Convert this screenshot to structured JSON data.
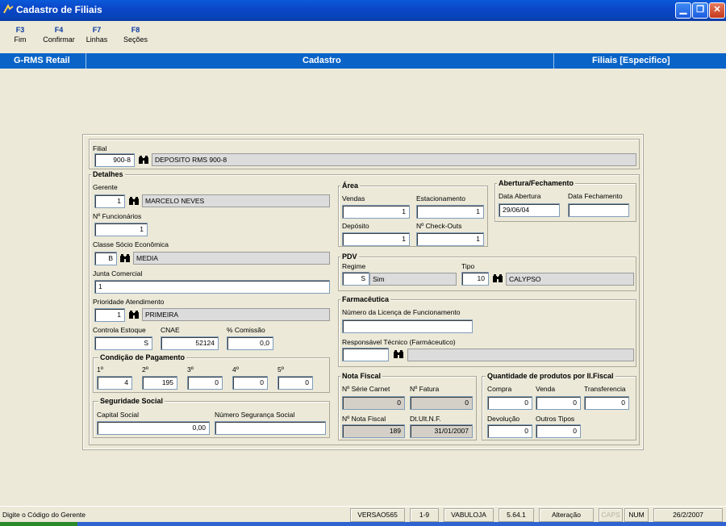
{
  "window": {
    "title": "Cadastro de Filiais"
  },
  "toolbar": {
    "keys": [
      {
        "key": "F3",
        "label": "Fim"
      },
      {
        "key": "F4",
        "label": "Confirmar"
      },
      {
        "key": "F7",
        "label": "Linhas"
      },
      {
        "key": "F8",
        "label": "Seções"
      }
    ]
  },
  "header": {
    "app": "G-RMS Retail",
    "section": "Cadastro",
    "context": "Filiais [Especifico]"
  },
  "filial": {
    "label": "Filial",
    "code": "900-8",
    "desc": "DEPOSITO RMS 900-8"
  },
  "detalhes": {
    "title": "Detalhes",
    "gerente_label": "Gerente",
    "gerente_code": "1",
    "gerente_desc": "MARCELO NEVES",
    "funcionarios_label": "Nº Funcionários",
    "funcionarios": "1",
    "classe_label": "Classe Sócio Econômica",
    "classe_code": "B",
    "classe_desc": "MEDIA",
    "junta_label": "Junta Comercial",
    "junta": "1",
    "prioridade_label": "Prioridade Atendimento",
    "prioridade_code": "1",
    "prioridade_desc": "PRIMEIRA",
    "estoque_label": "Controla Estoque",
    "estoque": "S",
    "cnae_label": "CNAE",
    "cnae": "52124",
    "comissao_label": "% Comissão",
    "comissao": "0,0"
  },
  "pagamento": {
    "title": "Condição de Pagamento",
    "labels": [
      "1º",
      "2º",
      "3º",
      "4º",
      "5º"
    ],
    "values": [
      "4",
      "195",
      "0",
      "0",
      "0"
    ]
  },
  "seguridade": {
    "title": "Seguridade Social",
    "capital_label": "Capital Social",
    "capital": "0,00",
    "numero_label": "Número Segurança Social",
    "numero": ""
  },
  "area": {
    "title": "Área",
    "vendas_label": "Vendas",
    "vendas": "1",
    "estac_label": "Estacionamento",
    "estac": "1",
    "deposito_label": "Depósito",
    "deposito": "1",
    "checkouts_label": "Nº Check-Outs",
    "checkouts": "1"
  },
  "abertura": {
    "title": "Abertura/Fechamento",
    "abertura_label": "Data Abertura",
    "abertura": "29/06/04",
    "fechamento_label": "Data Fechamento",
    "fechamento": ""
  },
  "pdv": {
    "title": "PDV",
    "regime_label": "Regime",
    "regime_code": "S",
    "regime_desc": "Sim",
    "tipo_label": "Tipo",
    "tipo_code": "10",
    "tipo_desc": "CALYPSO"
  },
  "farmaceutica": {
    "title": "Farmacêutica",
    "licenca_label": "Número da Licença de Funcionamento",
    "licenca": "",
    "resp_label": "Responsável Técnico (Farmáceutico)",
    "resp_code": "",
    "resp_desc": ""
  },
  "nota": {
    "title": "Nota Fiscal",
    "serie_label": "Nº Série Carnet",
    "serie": "0",
    "fatura_label": "Nº Fatura",
    "fatura": "0",
    "nf_label": "Nº Nota Fiscal",
    "nf": "189",
    "dtult_label": "Dt.Ult.N.F.",
    "dtult": "31/01/2007"
  },
  "qtd": {
    "title": "Quantidade de produtos por Il.Fiscal",
    "compra_label": "Compra",
    "compra": "0",
    "venda_label": "Venda",
    "venda": "0",
    "transf_label": "Transferencia",
    "transf": "0",
    "devol_label": "Devolução",
    "devol": "0",
    "outros_label": "Outros Tipos",
    "outros": "0"
  },
  "status": {
    "message": "Digite o Código do Gerente",
    "cells": [
      "VERSAO565",
      "1-9",
      "VABULOJA",
      "5.64.1",
      "Alteração",
      "CAPS",
      "NUM",
      "26/2/2007"
    ]
  },
  "colors": {
    "titlebar": "#0b47c9",
    "headbar": "#0a64c8",
    "background": "#ece9d8"
  }
}
